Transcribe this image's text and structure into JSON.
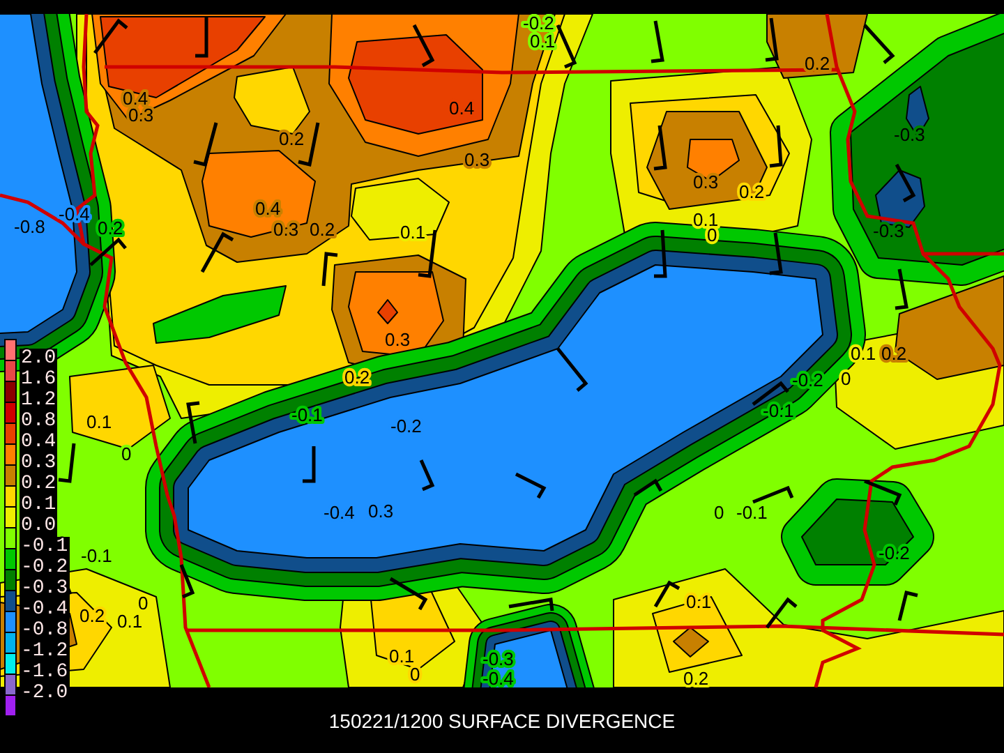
{
  "title": "150221/1200 SURFACE DIVERGENCE",
  "legend": {
    "swatches": [
      {
        "color": "#ff7070"
      },
      {
        "color": "#e84848"
      },
      {
        "color": "#8b0000"
      },
      {
        "color": "#d00000"
      },
      {
        "color": "#e84000"
      },
      {
        "color": "#ff8000"
      },
      {
        "color": "#c88000"
      },
      {
        "color": "#ffd700"
      },
      {
        "color": "#eeee00"
      },
      {
        "color": "#80ff00"
      },
      {
        "color": "#00c800"
      },
      {
        "color": "#008000"
      },
      {
        "color": "#104e8b"
      },
      {
        "color": "#1e90ff"
      },
      {
        "color": "#00b2ee"
      },
      {
        "color": "#00eeee"
      },
      {
        "color": "#8968cd"
      },
      {
        "color": "#a020f0"
      }
    ],
    "labels": [
      "2.0",
      "1.6",
      "1.2",
      "0.8",
      "0.4",
      "0.3",
      "0.2",
      "0.1",
      "0.0",
      "-0.1",
      "-0.2",
      "-0.3",
      "-0.4",
      "-0.8",
      "-1.2",
      "-1.6",
      "-2.0"
    ]
  },
  "contour_labels": [
    "-0.2",
    "0.1",
    "0.2",
    "0.4",
    "0.3",
    "0.4",
    "-0.3",
    "0.2",
    "0.3",
    "0.3",
    "0.2",
    "0.4",
    "-0.4",
    "0.1",
    "-0.8",
    "0.2",
    "0.3",
    "0.2",
    "0.1",
    "0",
    "-0.3",
    "0.3",
    "0.1",
    "0.2",
    "0.2",
    "-0.2",
    "0",
    "0.1",
    "-0.1",
    "-0.2",
    "-0.1",
    "0",
    "-0.4",
    "0.3",
    "0",
    "-0.1",
    "-0.1",
    "-0.2",
    "0",
    "0.1",
    "0.2",
    "0.1",
    "0.1",
    "-0.3",
    "0",
    "-0.4",
    "0.2"
  ]
}
